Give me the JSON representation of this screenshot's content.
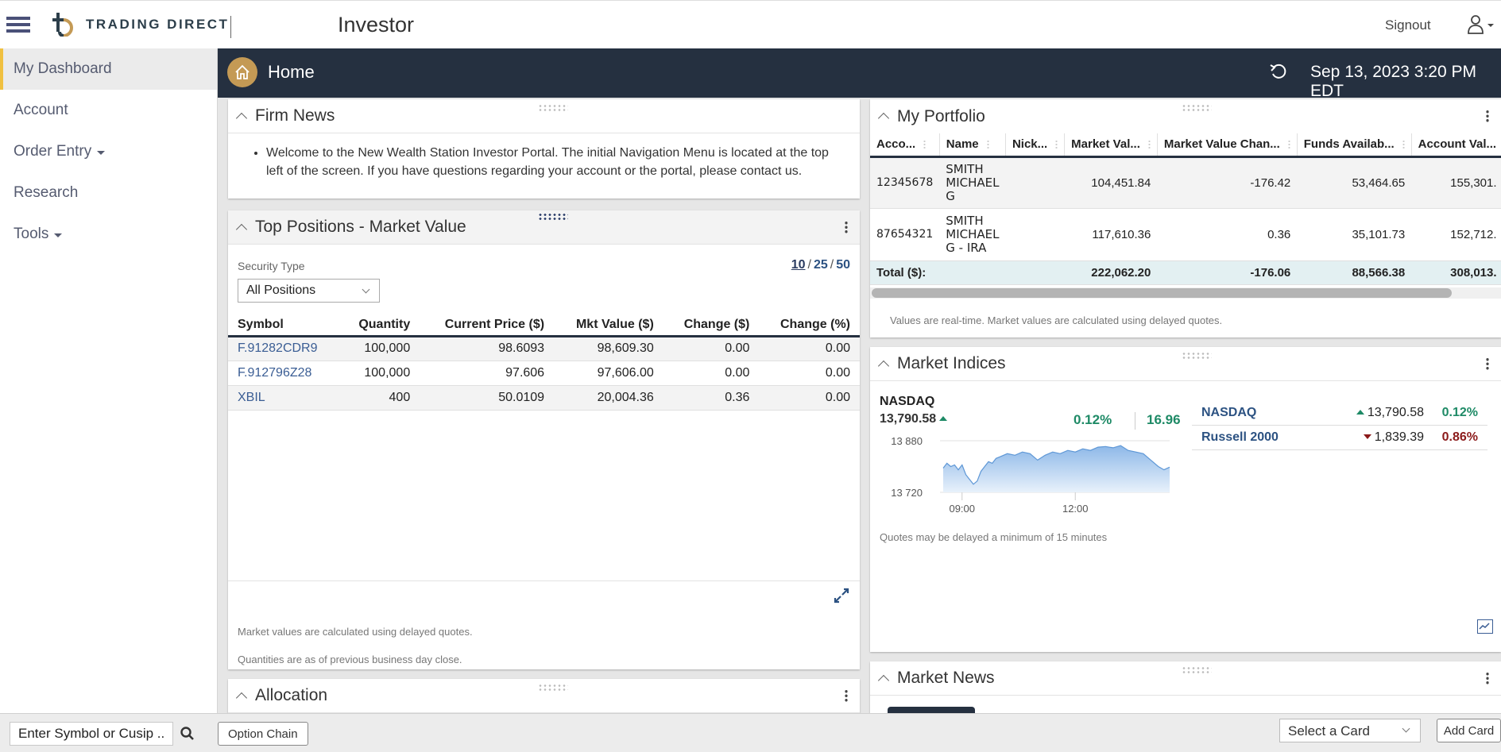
{
  "header": {
    "brand": "TRADING DIRECT",
    "app_title": "Investor",
    "signout_label": "Signout"
  },
  "sidebar": {
    "items": [
      {
        "label": "My Dashboard",
        "active": true,
        "has_dropdown": false
      },
      {
        "label": "Account",
        "active": false,
        "has_dropdown": false
      },
      {
        "label": "Order Entry",
        "active": false,
        "has_dropdown": true
      },
      {
        "label": "Research",
        "active": false,
        "has_dropdown": false
      },
      {
        "label": "Tools",
        "active": false,
        "has_dropdown": true
      }
    ]
  },
  "homebar": {
    "title": "Home",
    "datetime": "Sep 13, 2023 3:20 PM EDT"
  },
  "firm_news": {
    "title": "Firm News",
    "items": [
      "Welcome to the New Wealth Station Investor Portal. The initial Navigation Menu is located at the top left of the screen. If you have questions regarding your account or the portal, please contact us."
    ]
  },
  "top_positions": {
    "title": "Top Positions - Market Value",
    "security_type_label": "Security Type",
    "security_type_value": "All Positions",
    "page_sizes": [
      "10",
      "25",
      "50"
    ],
    "page_size_current": "10",
    "columns": [
      "Symbol",
      "Quantity",
      "Current Price ($)",
      "Mkt Value ($)",
      "Change ($)",
      "Change (%)"
    ],
    "rows": [
      [
        "F.91282CDR9",
        "100,000",
        "98.6093",
        "98,609.30",
        "0.00",
        "0.00"
      ],
      [
        "F.912796Z28",
        "100,000",
        "97.606",
        "97,606.00",
        "0.00",
        "0.00"
      ],
      [
        "XBIL",
        "400",
        "50.0109",
        "20,004.36",
        "0.36",
        "0.00"
      ]
    ],
    "notes": [
      "Market values are calculated using delayed quotes.",
      "Quantities are as of previous business day close."
    ]
  },
  "allocation": {
    "title": "Allocation"
  },
  "portfolio": {
    "title": "My Portfolio",
    "columns": [
      "Acco...",
      "Name",
      "Nick...",
      "Market Val...",
      "Market Value Chan...",
      "Funds Availab...",
      "Account Val..."
    ],
    "rows": [
      {
        "account": "12345678",
        "name": "SMITH MICHAEL G",
        "nickname": "",
        "market_value": "104,451.84",
        "mv_change": "-176.42",
        "funds_available": "53,464.65",
        "account_value": "155,301.",
        "mv_change_negative": true
      },
      {
        "account": "87654321",
        "name": "SMITH MICHAEL G - IRA",
        "nickname": "",
        "market_value": "117,610.36",
        "mv_change": "0.36",
        "funds_available": "35,101.73",
        "account_value": "152,712.",
        "mv_change_negative": false
      }
    ],
    "total": {
      "label": "Total ($):",
      "market_value": "222,062.20",
      "mv_change": "-176.06",
      "funds_available": "88,566.38",
      "account_value": "308,013."
    },
    "note": "Values are real-time. Market values are calculated using delayed quotes."
  },
  "market_indices": {
    "title": "Market Indices",
    "featured": {
      "name": "NASDAQ",
      "value": "13,790.58",
      "direction": "up",
      "pct_change": "0.12%",
      "change": "16.96"
    },
    "list": [
      {
        "name": "NASDAQ",
        "value": "13,790.58",
        "direction": "up",
        "pct": "0.12%"
      },
      {
        "name": "Russell 2000",
        "value": "1,839.39",
        "direction": "down",
        "pct": "0.86%"
      }
    ],
    "note": "Quotes may be delayed a minimum of 15 minutes"
  },
  "chart_data": {
    "type": "area",
    "title": "NASDAQ",
    "xlabel": "",
    "ylabel": "",
    "y_tick_labels": [
      "13 880",
      "13 720"
    ],
    "y_ticks": [
      13880,
      13720
    ],
    "ylim": [
      13720,
      13880
    ],
    "x_tick_labels": [
      "09:00",
      "12:00"
    ],
    "x_ticks": [
      9.0,
      12.0
    ],
    "xlim": [
      8.5,
      14.5
    ],
    "x": [
      8.5,
      8.6,
      8.7,
      8.8,
      8.9,
      9.0,
      9.1,
      9.2,
      9.3,
      9.4,
      9.5,
      9.6,
      9.7,
      9.8,
      9.9,
      10.0,
      10.2,
      10.4,
      10.6,
      10.8,
      11.0,
      11.2,
      11.4,
      11.6,
      11.8,
      12.0,
      12.2,
      12.4,
      12.6,
      12.8,
      13.0,
      13.2,
      13.4,
      13.6,
      13.8,
      14.0,
      14.2,
      14.35,
      14.5
    ],
    "values": [
      13795,
      13810,
      13800,
      13805,
      13790,
      13805,
      13775,
      13760,
      13745,
      13755,
      13785,
      13800,
      13815,
      13810,
      13825,
      13830,
      13840,
      13835,
      13845,
      13840,
      13820,
      13835,
      13845,
      13840,
      13850,
      13845,
      13855,
      13850,
      13860,
      13862,
      13858,
      13865,
      13850,
      13845,
      13840,
      13820,
      13800,
      13790,
      13798
    ],
    "grid": true,
    "legend": "none"
  },
  "market_news": {
    "title": "Market News"
  },
  "bottombar": {
    "symbol_placeholder": "Enter Symbol or Cusip ...",
    "option_chain_label": "Option Chain",
    "select_card_label": "Select a Card",
    "add_card_label": "Add Card"
  },
  "colors": {
    "navy": "#253040",
    "gold": "#c49a55",
    "active_accent": "#f0c040",
    "positive": "#1e8a66",
    "negative": "#8b1a1a",
    "link": "#2c5282"
  }
}
